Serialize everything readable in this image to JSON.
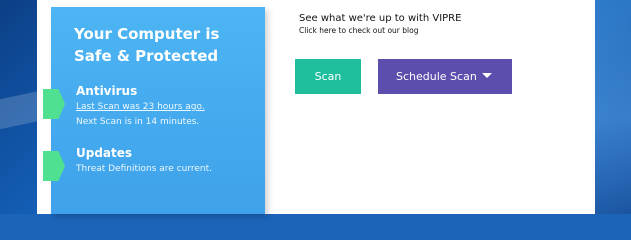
{
  "status_panel": {
    "title_line1": "Your Computer is",
    "title_line2": "Safe & Protected",
    "antivirus": {
      "heading": "Antivirus",
      "last_scan": "Last Scan was 23 hours ago.",
      "next_scan": "Next Scan is in 14 minutes."
    },
    "updates": {
      "heading": "Updates",
      "status": "Threat Definitions are current."
    },
    "accent_color": "#4fe091",
    "panel_color": "#44a9ee"
  },
  "blog": {
    "title": "See what we're up to with VIPRE",
    "link": "Click here to check out our blog"
  },
  "actions": {
    "scan_label": "Scan",
    "schedule_label": "Schedule Scan",
    "scan_color": "#1fbf9e",
    "schedule_color": "#5c4eac"
  }
}
